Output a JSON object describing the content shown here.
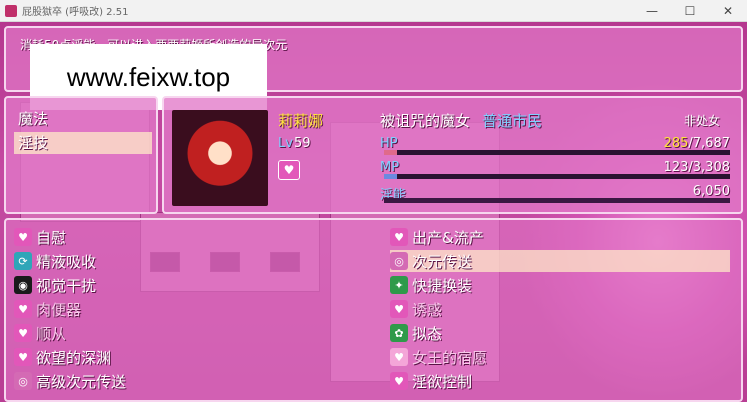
{
  "window": {
    "title": "屁股獄卒 (呼吸改) 2.51",
    "controls": [
      "—",
      "☐",
      "✕"
    ]
  },
  "message": "消耗50点淫能，可以进入西西莉姬所创造的异次元",
  "watermark": "www.feixw.top",
  "skill_types": [
    {
      "label": "魔法",
      "selected": false
    },
    {
      "label": "淫技",
      "selected": true
    }
  ],
  "actor": {
    "name": "莉莉娜",
    "level_label": "Lv",
    "level": "59",
    "class": "被诅咒的魔女",
    "class2": "普通市民",
    "nickname": "非处女",
    "state_icon": "heart-icon"
  },
  "gauges": [
    {
      "label": "HP",
      "current": "285",
      "max": "/7,687",
      "fraction": 0.037,
      "color": "#e06a8a"
    },
    {
      "label": "MP",
      "current": "123",
      "max": "/3,308",
      "fraction": 0.037,
      "color": "#6a8ae0"
    },
    {
      "label": "淫能",
      "current": "",
      "max": "6,050",
      "fraction": 1.0,
      "color": "#3a1842"
    }
  ],
  "skills": [
    {
      "label": "自慰",
      "icon": "heart-icon",
      "icon_bg": "#e257b9",
      "glyph": "♥",
      "col": 0,
      "row": 0,
      "selected": false,
      "dim": false
    },
    {
      "label": "出产&流产",
      "icon": "heart-icon",
      "icon_bg": "#e257b9",
      "glyph": "♥",
      "col": 1,
      "row": 0,
      "selected": false,
      "dim": false
    },
    {
      "label": "精液吸收",
      "icon": "recycle-icon",
      "icon_bg": "#2fa6b8",
      "glyph": "⟳",
      "col": 0,
      "row": 1,
      "selected": false,
      "dim": false
    },
    {
      "label": "次元传送",
      "icon": "portal-icon",
      "icon_bg": "#d46ab4",
      "glyph": "◎",
      "col": 1,
      "row": 1,
      "selected": true,
      "dim": false
    },
    {
      "label": "视觉干扰",
      "icon": "eye-icon",
      "icon_bg": "#1a1a1a",
      "glyph": "◉",
      "col": 0,
      "row": 2,
      "selected": false,
      "dim": false
    },
    {
      "label": "快捷换装",
      "icon": "outfit-icon",
      "icon_bg": "#2f9a4a",
      "glyph": "✦",
      "col": 1,
      "row": 2,
      "selected": false,
      "dim": false
    },
    {
      "label": "肉便器",
      "icon": "heart-icon",
      "icon_bg": "#e257b9",
      "glyph": "♥",
      "col": 0,
      "row": 3,
      "selected": false,
      "dim": true
    },
    {
      "label": "诱惑",
      "icon": "heart-icon",
      "icon_bg": "#e257b9",
      "glyph": "♥",
      "col": 1,
      "row": 3,
      "selected": false,
      "dim": true
    },
    {
      "label": "顺从",
      "icon": "heart-icon",
      "icon_bg": "#e257b9",
      "glyph": "♥",
      "col": 0,
      "row": 4,
      "selected": false,
      "dim": true
    },
    {
      "label": "拟态",
      "icon": "mimic-icon",
      "icon_bg": "#2f9a4a",
      "glyph": "✿",
      "col": 1,
      "row": 4,
      "selected": false,
      "dim": false
    },
    {
      "label": "欲望的深渊",
      "icon": "heart-icon",
      "icon_bg": "#e257b9",
      "glyph": "♥",
      "col": 0,
      "row": 5,
      "selected": false,
      "dim": false
    },
    {
      "label": "女王的宿愿",
      "icon": "heart-icon",
      "icon_bg": "#f4a6d8",
      "glyph": "♥",
      "col": 1,
      "row": 5,
      "selected": false,
      "dim": true
    },
    {
      "label": "高级次元传送",
      "icon": "portal-icon",
      "icon_bg": "#d46ab4",
      "glyph": "◎",
      "col": 0,
      "row": 6,
      "selected": false,
      "dim": false
    },
    {
      "label": "淫欲控制",
      "icon": "heart-icon",
      "icon_bg": "#e257b9",
      "glyph": "♥",
      "col": 1,
      "row": 6,
      "selected": false,
      "dim": false
    }
  ]
}
